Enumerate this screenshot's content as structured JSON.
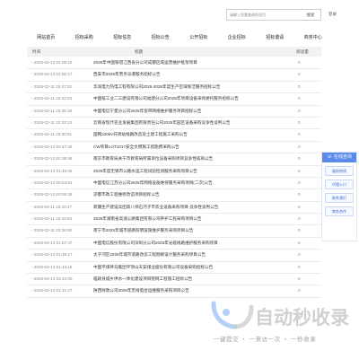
{
  "header": {
    "search_placeholder": "请输入您要查询的项目",
    "search_button": "搜索",
    "login_text": "登录"
  },
  "nav": {
    "items": [
      {
        "label": "网站首页"
      },
      {
        "label": "招标采购"
      },
      {
        "label": "招标信息"
      },
      {
        "label": "招标公告"
      },
      {
        "label": "公开招标"
      },
      {
        "label": "企业招标"
      },
      {
        "label": "招标邀请"
      },
      {
        "label": "商务中心"
      }
    ]
  },
  "table": {
    "headers": {
      "time": "时间",
      "title": "标题",
      "views": "阅读量"
    },
    "rows": [
      {
        "time": "2025-02-12 01:55:15",
        "title": "2025年中国铁塔江西省分公司成都区域运营维护框架项目",
        "views": "0"
      },
      {
        "time": "2025-02-12 01:50:17",
        "title": "西安市2025年劳务派遣服务招标公告",
        "views": "0"
      },
      {
        "time": "2025-02-11 23:47:02",
        "title": "华润电力热电工程有限公司2025-2026年度生产区域保洁服务招标公告",
        "views": "0"
      },
      {
        "time": "2025-02-11 23:42:03",
        "title": "中国核工业二三建设有限公司福建分公司2025年项目设备采购委托服务招标公告",
        "views": "0"
      },
      {
        "time": "2025-02-11 23:38:19",
        "title": "中国电信宁夏分公司2025年宽带网络维护服务项目招标公告",
        "views": "0"
      },
      {
        "time": "2025-02-11 23:33:13",
        "title": "云南省现代农业发展集团有限责任公司2025年园区设备采购竞争性谈判公告",
        "views": "0"
      },
      {
        "time": "2025-02-11 23:30:51",
        "title": "国网220kV开闭站线路改造及土建工程施工采购公告",
        "views": "0"
      },
      {
        "time": "2025-02-12 00:47:28",
        "title": "CW项目LOT1017安全文明施工措施费采购公告",
        "views": "0"
      },
      {
        "time": "2025-02-12 01:36:48",
        "title": "南京市教育局关于市教育局所属单位设备采购项目竞争性磋商公告",
        "views": "0"
      },
      {
        "time": "2025-02-12 01:45:36",
        "title": "2025年度无锡市公路水运工程试验检测服务采购项目公告",
        "views": "0"
      },
      {
        "time": "2025-02-12 00:54:54",
        "title": "中国电信江苏分公司2025年网络设备维保服务采购项目(二次)公告",
        "views": "0"
      },
      {
        "time": "2025-02-12 00:05:28",
        "title": "凉都市政工程维修改造项目招标公告",
        "views": "0"
      },
      {
        "time": "2025-02-11 23:44:47",
        "title": "新疆生产建设兵团第八师石河子市农业设备采购项目-竞争性谈判公告",
        "views": "0"
      },
      {
        "time": "2025-02-11 23:42:53",
        "title": "2025年湖南省高速公路集团有限公司养护工程采购项目公告",
        "views": "0"
      },
      {
        "time": "2025-02-11 23:36:00",
        "title": "南宁市2025年城市道路照明设施维护服务采购项目公告",
        "views": "0"
      },
      {
        "time": "2025-02-12 01:57:47",
        "title": "中国电信股份有限公司深圳分公司2025年光缆线路维护服务采购项目",
        "views": "0"
      },
      {
        "time": "2025-02-12 01:35:17",
        "title": "太子河区2025年城市道路改造工程勘察设计服务采购项目公告",
        "views": "0"
      },
      {
        "time": "2025-02-12 01:43:15",
        "title": "中国平煤神马集团平顶山天安煤业股份有限公司设备采购招标公告",
        "views": "0"
      },
      {
        "time": "2025-02-12 02:43:00",
        "title": "临颍县城乡供水一体化建设项目管网工程施工招标公告",
        "views": "0"
      },
      {
        "time": "2025-02-12 01:21:27",
        "title": "陕西财政公司2025年无线电台运维服务采购项目公告",
        "views": "0"
      }
    ]
  },
  "float_panel": {
    "title": "在线咨询",
    "buttons": [
      {
        "label": "服务热线"
      },
      {
        "label": "代理入口"
      },
      {
        "label": "联系我们"
      },
      {
        "label": "商务合作"
      }
    ]
  },
  "watermark": {
    "title": "自动秒收录",
    "subtitle": "一键提交 ・ 一来访一次 ・ 一秒收录"
  },
  "colors": {
    "accent": "#5b8be8",
    "header_bg": "#f2f2f2"
  }
}
